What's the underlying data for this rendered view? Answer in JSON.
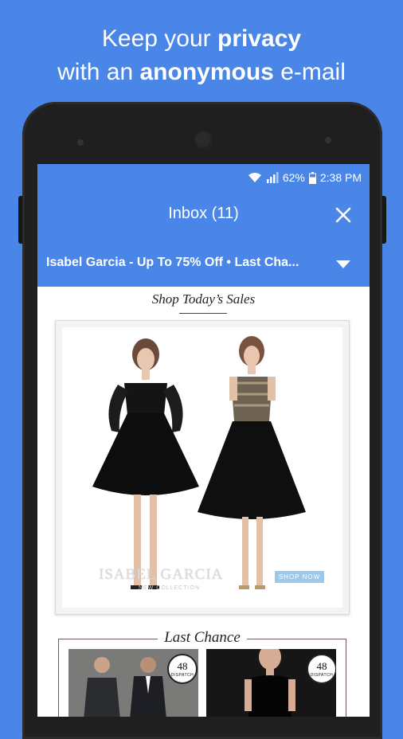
{
  "headline": {
    "line1_pre": "Keep your ",
    "line1_bold": "privacy",
    "line2_pre": "with an ",
    "line2_bold": "anonymous",
    "line2_post": " e-mail"
  },
  "status_bar": {
    "battery": "62%",
    "time": "2:38 PM"
  },
  "inbox": {
    "title": "Inbox (11)",
    "subject": "Isabel Garcia - Up To 75% Off • Last Cha..."
  },
  "email": {
    "section_title": "Shop Today’s Sales",
    "brand": "ISABEL GARCIA",
    "brand_sub": "NEW COLLECTION",
    "shop_now": "SHOP NOW",
    "last_chance": "Last Chance",
    "badges": [
      {
        "number": "48",
        "label": "DISPATCH"
      },
      {
        "number": "48",
        "label": "DISPATCH"
      }
    ]
  },
  "colors": {
    "brand_blue": "#4a86e8",
    "phone_body": "#1f1f1f"
  }
}
